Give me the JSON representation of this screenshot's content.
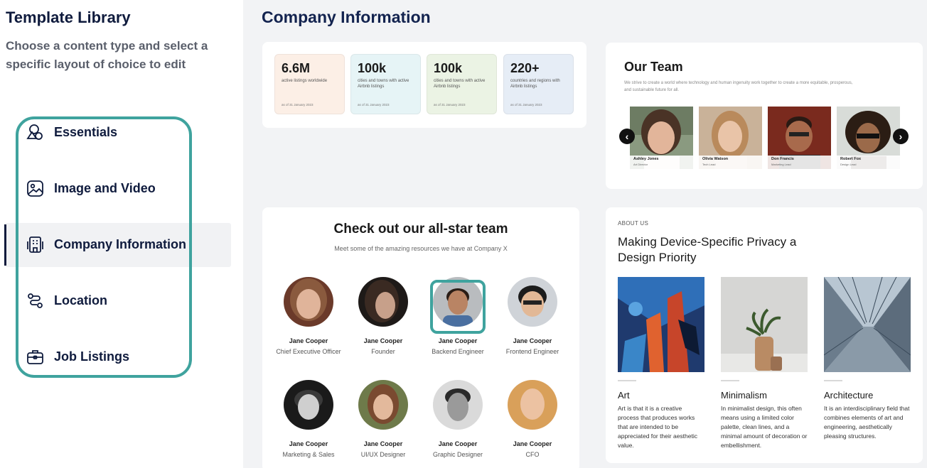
{
  "sidebar": {
    "title": "Template Library",
    "subtitle": "Choose a content type and select a specific layout of choice to edit",
    "items": [
      {
        "label": "Essentials",
        "icon": "shapes-icon"
      },
      {
        "label": "Image and Video",
        "icon": "image-icon"
      },
      {
        "label": "Company Information",
        "icon": "building-icon",
        "active": true
      },
      {
        "label": "Location",
        "icon": "route-icon"
      },
      {
        "label": "Job Listings",
        "icon": "briefcase-icon"
      }
    ]
  },
  "main": {
    "title": "Company Information",
    "stats": [
      {
        "value": "6.6M",
        "desc": "active listings worldwide",
        "date": "as of 31 January 2023",
        "color": "#fcefe6"
      },
      {
        "value": "100k",
        "desc": "cities and towns with active Airbnb listings",
        "date": "as of 31 January 2023",
        "color": "#e6f4f6"
      },
      {
        "value": "100k",
        "desc": "cities and towns with active Airbnb listings",
        "date": "as of 31 January 2023",
        "color": "#ebf3e4"
      },
      {
        "value": "220+",
        "desc": "countries and regions with Airbnb listings",
        "date": "as of 31 January 2023",
        "color": "#e6edf6"
      }
    ],
    "our_team": {
      "title": "Our Team",
      "subtitle": "We strive to create a world where technology and human ingenuity work together to create a more equitable, prosperous, and sustainable future for all.",
      "members": [
        {
          "name": "Ashley Jones",
          "role": "Art Director"
        },
        {
          "name": "Olivia Watson",
          "role": "Tech Lead"
        },
        {
          "name": "Don Francis",
          "role": "Marketing Lead"
        },
        {
          "name": "Robert Fox",
          "role": "Design Lead"
        }
      ],
      "prev_arrow": "‹",
      "next_arrow": "›"
    },
    "team_grid": {
      "title": "Check out our all-star team",
      "subtitle": "Meet some of the amazing resources we have at Company X",
      "members": [
        {
          "name": "Jane Cooper",
          "role": "Chief Executive Officer"
        },
        {
          "name": "Jane Cooper",
          "role": "Founder"
        },
        {
          "name": "Jane Cooper",
          "role": "Backend Engineer"
        },
        {
          "name": "Jane Cooper",
          "role": "Frontend Engineer"
        },
        {
          "name": "Jane Cooper",
          "role": "Marketing & Sales"
        },
        {
          "name": "Jane Cooper",
          "role": "UI/UX Designer"
        },
        {
          "name": "Jane Cooper",
          "role": "Graphic Designer"
        },
        {
          "name": "Jane Cooper",
          "role": "CFO"
        }
      ]
    },
    "about": {
      "overline": "ABOUT US",
      "heading": "Making Device-Specific Privacy a Design Priority",
      "columns": [
        {
          "title": "Art",
          "desc": "Art is that it is a creative process that produces works that are intended to be appreciated for their aesthetic value."
        },
        {
          "title": "Minimalism",
          "desc": "In minimalist design, this often means using a limited color palette, clean lines, and a minimal amount of decoration or embellishment."
        },
        {
          "title": "Architecture",
          "desc": " It is an interdisciplinary field that combines elements of art and engineering, aesthetically pleasing structures."
        }
      ]
    }
  }
}
